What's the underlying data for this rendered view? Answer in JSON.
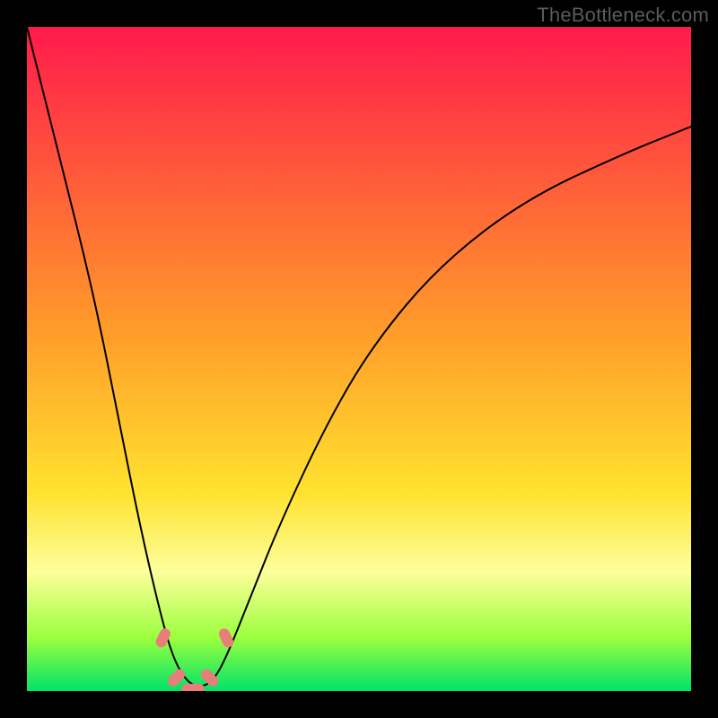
{
  "watermark": "TheBottleneck.com",
  "colors": {
    "red": "#ff1a4b",
    "orange": "#ff7a23",
    "yellow": "#ffe22e",
    "pale_yellow": "#feff9c",
    "lime": "#9bff3d",
    "green": "#00e26a",
    "curve": "#000000",
    "marker": "#e77e7b",
    "frame": "#000000"
  },
  "chart_data": {
    "type": "line",
    "x": [
      0.0,
      0.05,
      0.1,
      0.14,
      0.17,
      0.2,
      0.22,
      0.24,
      0.26,
      0.28,
      0.3,
      0.34,
      0.38,
      0.45,
      0.52,
      0.62,
      0.75,
      0.9,
      1.0
    ],
    "y": [
      1.0,
      0.8,
      0.6,
      0.4,
      0.25,
      0.12,
      0.05,
      0.015,
      0.005,
      0.015,
      0.05,
      0.15,
      0.25,
      0.4,
      0.52,
      0.64,
      0.74,
      0.81,
      0.85
    ],
    "title": "",
    "xlabel": "",
    "ylabel": "",
    "xlim": [
      0,
      1
    ],
    "ylim": [
      0,
      1
    ],
    "markers_x": [
      0.205,
      0.225,
      0.25,
      0.275,
      0.3
    ],
    "markers_y": [
      0.08,
      0.02,
      0.003,
      0.02,
      0.08
    ],
    "gradient_stops": [
      {
        "offset": 0.0,
        "color": "#ff1a4b"
      },
      {
        "offset": 0.45,
        "color": "#ff9a2a"
      },
      {
        "offset": 0.7,
        "color": "#ffe22e"
      },
      {
        "offset": 0.82,
        "color": "#feff9c"
      },
      {
        "offset": 0.92,
        "color": "#9bff3d"
      },
      {
        "offset": 1.0,
        "color": "#00e26a"
      }
    ]
  }
}
